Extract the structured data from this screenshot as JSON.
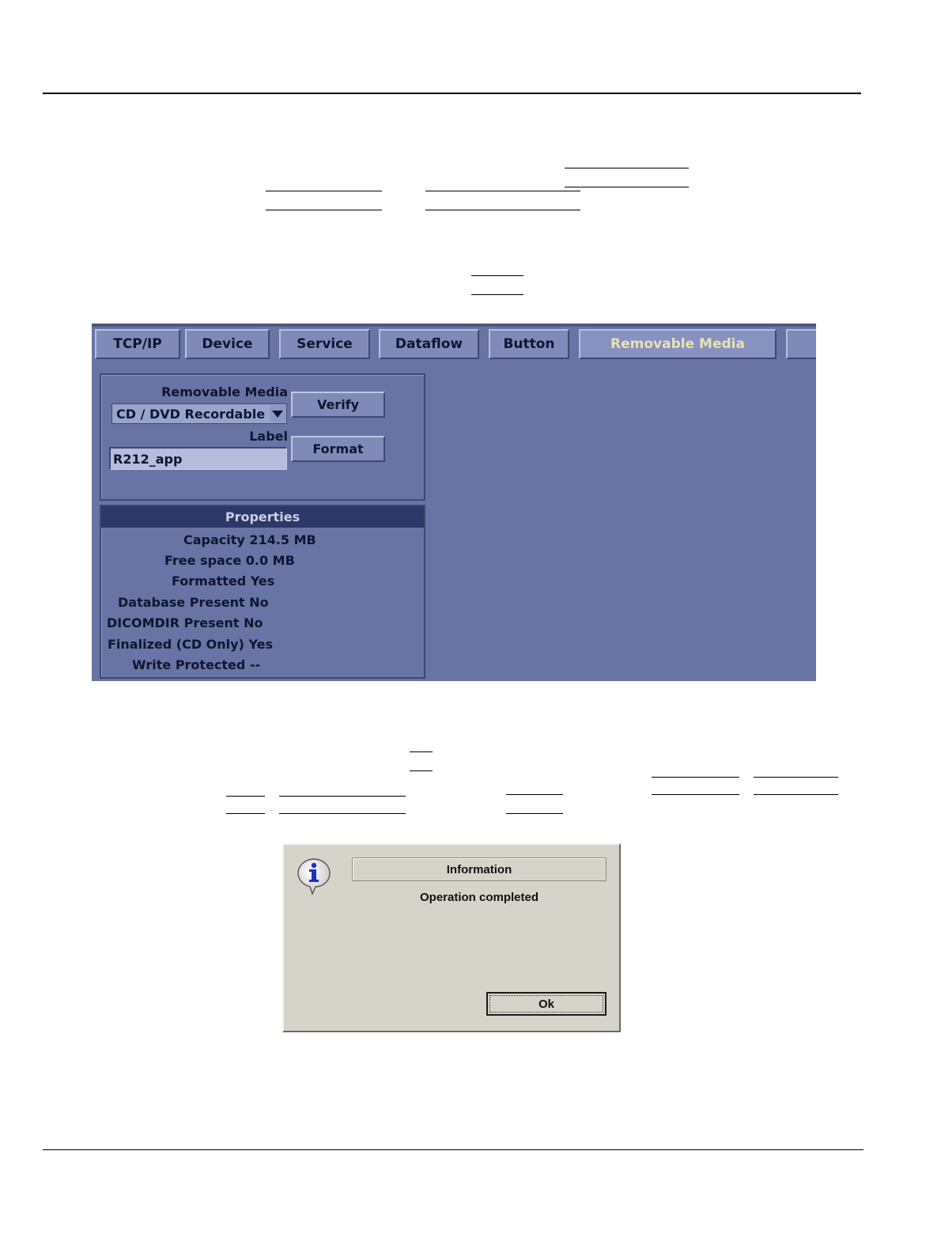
{
  "tabs": [
    {
      "label": "TCP/IP",
      "active": false
    },
    {
      "label": "Device",
      "active": false
    },
    {
      "label": "Service",
      "active": false
    },
    {
      "label": "Dataflow",
      "active": false
    },
    {
      "label": "Button",
      "active": false
    },
    {
      "label": "Removable Media",
      "active": true
    },
    {
      "label": "",
      "active": false
    }
  ],
  "media_panel": {
    "media_label": "Removable Media",
    "media_value": "CD / DVD Recordable",
    "label_label": "Label",
    "label_value": "R212_app",
    "verify_button": "Verify",
    "format_button": "Format"
  },
  "properties": {
    "header": "Properties",
    "rows": [
      {
        "label": "Capacity",
        "value": "214.5 MB"
      },
      {
        "label": "Free space",
        "value": "0.0 MB"
      },
      {
        "label": "Formatted",
        "value": "Yes"
      },
      {
        "label": "Database Present",
        "value": "No"
      },
      {
        "label": "DICOMDIR Present",
        "value": "No"
      },
      {
        "label": "Finalized (CD Only)",
        "value": "Yes"
      },
      {
        "label": "Write Protected",
        "value": "--"
      }
    ]
  },
  "dialog": {
    "title": "Information",
    "message": "Operation completed",
    "ok_button": "Ok",
    "icon": "info-icon"
  },
  "colors": {
    "screen_bg": "#6874a3",
    "active_tab_text": "#e8e2b2",
    "properties_header_bg": "#2e3868",
    "dialog_bg": "#d6d3ca"
  }
}
